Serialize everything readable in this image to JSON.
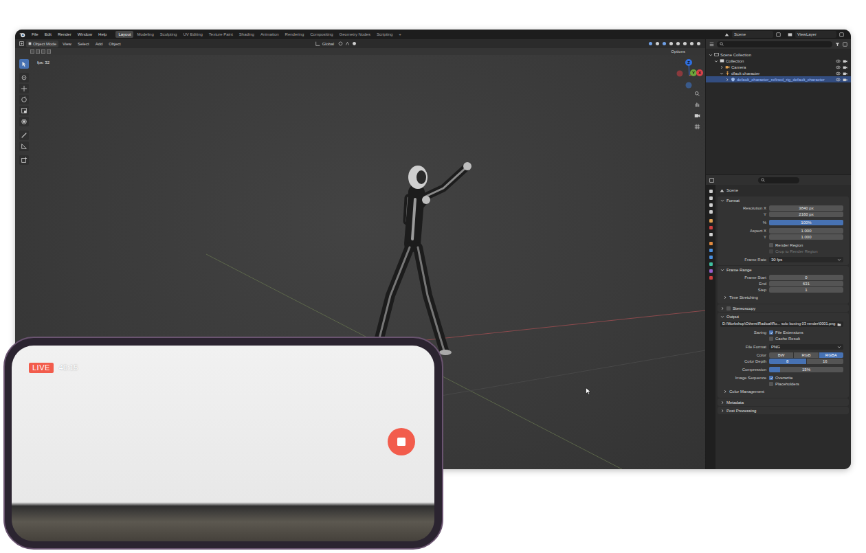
{
  "topbar": {
    "menus": [
      "File",
      "Edit",
      "Render",
      "Window",
      "Help"
    ],
    "workspaces": [
      {
        "label": "Layout",
        "selected": true
      },
      {
        "label": "Modeling",
        "selected": false
      },
      {
        "label": "Sculpting",
        "selected": false
      },
      {
        "label": "UV Editing",
        "selected": false
      },
      {
        "label": "Texture Paint",
        "selected": false
      },
      {
        "label": "Shading",
        "selected": false
      },
      {
        "label": "Animation",
        "selected": false
      },
      {
        "label": "Rendering",
        "selected": false
      },
      {
        "label": "Compositing",
        "selected": false
      },
      {
        "label": "Geometry Nodes",
        "selected": false
      },
      {
        "label": "Scripting",
        "selected": false
      }
    ],
    "add_workspace": "+",
    "scene": "Scene",
    "view_layer": "ViewLayer"
  },
  "viewport": {
    "mode": "Object Mode",
    "menus": [
      "View",
      "Select",
      "Add",
      "Object"
    ],
    "orientation": "Global",
    "options": "Options",
    "stats": "fps: 32",
    "gizmo_axes": [
      "Z",
      "Y",
      "X"
    ],
    "tools": [
      {
        "selected": true
      },
      {
        "selected": false
      },
      {
        "selected": false
      },
      {
        "selected": false
      },
      {
        "selected": false
      },
      {
        "selected": false
      },
      {
        "selected": false
      },
      {
        "selected": false
      },
      {
        "selected": false
      }
    ]
  },
  "outliner": {
    "items": [
      {
        "label": "Scene Collection",
        "depth": 0,
        "expanded": true,
        "selected": false,
        "kind": "scene"
      },
      {
        "label": "Collection",
        "depth": 1,
        "expanded": true,
        "selected": false,
        "kind": "collection"
      },
      {
        "label": "Camera",
        "depth": 2,
        "expanded": false,
        "selected": false,
        "kind": "camera"
      },
      {
        "label": "dfault character",
        "depth": 2,
        "expanded": true,
        "selected": false,
        "kind": "armature"
      },
      {
        "label": "default_character_refined_rig_default_character",
        "depth": 3,
        "expanded": false,
        "selected": true,
        "kind": "mesh"
      }
    ]
  },
  "properties": {
    "context": "Scene",
    "panels": [
      {
        "title": "Format",
        "expanded": true,
        "rows": [
          {
            "kind": "field",
            "label": "Resolution X",
            "value": "3840 px"
          },
          {
            "kind": "field",
            "label": "Y",
            "value": "2160 px"
          },
          {
            "kind": "slider",
            "label": "%",
            "value": "100%",
            "level": 1
          },
          {
            "kind": "field",
            "label": "Aspect X",
            "value": "1.000"
          },
          {
            "kind": "field",
            "label": "Y",
            "value": "1.000"
          },
          {
            "kind": "checkbox",
            "label": "Render Region",
            "checked": false,
            "disabled": false
          },
          {
            "kind": "checkbox",
            "label": "Crop to Render Region",
            "checked": false,
            "disabled": true
          },
          {
            "kind": "dropdown",
            "label": "Frame Rate",
            "value": "30 fps"
          }
        ]
      },
      {
        "title": "Frame Range",
        "expanded": true,
        "rows": [
          {
            "kind": "field",
            "label": "Frame Start",
            "value": "0"
          },
          {
            "kind": "field",
            "label": "End",
            "value": "631"
          },
          {
            "kind": "field",
            "label": "Step",
            "value": "1"
          },
          {
            "kind": "subpanel",
            "label": "Time Stretching",
            "expanded": false
          }
        ]
      },
      {
        "title": "Stereoscopy",
        "expanded": false,
        "checked": false,
        "rows": []
      },
      {
        "title": "Output",
        "expanded": true,
        "rows": [
          {
            "kind": "path",
            "value": "D:\\Workshop\\Others\\Radical\\Ru... solo boxing 03 render\\0001.png"
          },
          {
            "kind": "checkbox",
            "caption": "Saving",
            "label": "File Extensions",
            "checked": true,
            "disabled": false
          },
          {
            "kind": "checkbox",
            "label": "Cache Result",
            "checked": false,
            "disabled": false
          },
          {
            "kind": "dropdown",
            "label": "File Format",
            "value": "PNG"
          },
          {
            "kind": "segmented",
            "label": "Color",
            "options": [
              {
                "label": "BW",
                "selected": false
              },
              {
                "label": "RGB",
                "selected": false
              },
              {
                "label": "RGBA",
                "selected": true
              }
            ]
          },
          {
            "kind": "segmented",
            "label": "Color Depth",
            "options": [
              {
                "label": "8",
                "selected": true
              },
              {
                "label": "16",
                "selected": false
              }
            ]
          },
          {
            "kind": "slider",
            "label": "Compression",
            "value": "15%",
            "level": 0.15
          },
          {
            "kind": "checkbox",
            "caption": "Image Sequence",
            "label": "Overwrite",
            "checked": true,
            "disabled": false
          },
          {
            "kind": "checkbox",
            "label": "Placeholders",
            "checked": false,
            "disabled": false
          },
          {
            "kind": "subpanel",
            "label": "Color Management",
            "expanded": false
          }
        ]
      },
      {
        "title": "Metadata",
        "expanded": false,
        "rows": []
      },
      {
        "title": "Post Processing",
        "expanded": false,
        "rows": []
      }
    ]
  },
  "phone": {
    "live": "LIVE",
    "timer": "40:15",
    "recording": true
  }
}
